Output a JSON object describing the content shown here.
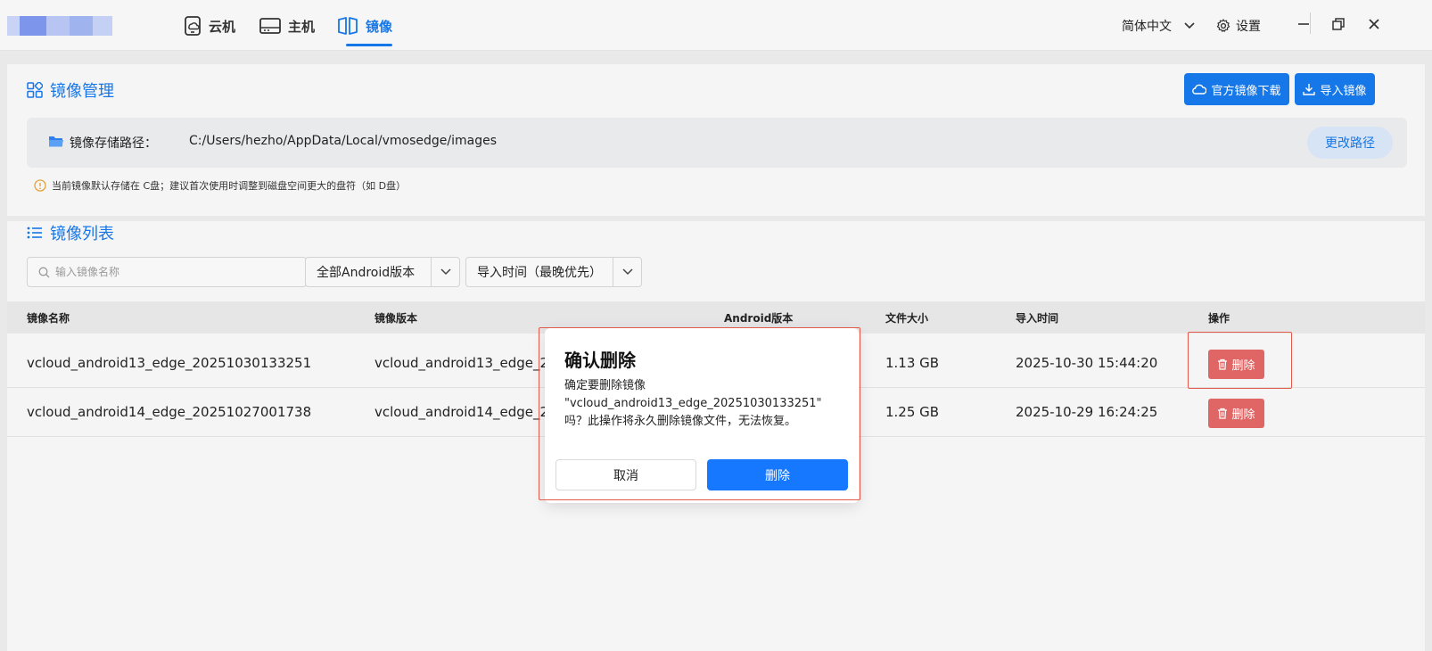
{
  "titlebar": {
    "tabs": [
      {
        "label": "云机",
        "icon": "cloud-phone-icon"
      },
      {
        "label": "主机",
        "icon": "host-icon"
      },
      {
        "label": "镜像",
        "icon": "mirror-icon",
        "active": true
      }
    ],
    "language": "简体中文",
    "settings_label": "设置"
  },
  "manage": {
    "title": "镜像管理",
    "download_button": "官方镜像下载",
    "import_button": "导入镜像",
    "path_label": "镜像存储路径：",
    "path_value": "C:/Users/hezho/AppData/Local/vmosedge/images",
    "change_path_button": "更改路径",
    "hint": "当前镜像默认存储在 C盘；建议首次使用时调整到磁盘空间更大的盘符（如 D盘）"
  },
  "list": {
    "title": "镜像列表",
    "search_placeholder": "输入镜像名称",
    "version_filter": "全部Android版本",
    "sort_filter": "导入时间（最晚优先）",
    "columns": [
      "镜像名称",
      "镜像版本",
      "Android版本",
      "文件大小",
      "导入时间",
      "操作"
    ],
    "rows": [
      {
        "name": "vcloud_android13_edge_20251030133251",
        "version": "vcloud_android13_edge_2025",
        "size": "1.13 GB",
        "time": "2025-10-30 15:44:20",
        "action": "删除"
      },
      {
        "name": "vcloud_android14_edge_20251027001738",
        "version": "vcloud_android14_edge_2025",
        "size": "1.25 GB",
        "time": "2025-10-29 16:24:25",
        "action": "删除"
      }
    ]
  },
  "dialog": {
    "title": "确认删除",
    "line1": "确定要删除镜像",
    "line2": "\"vcloud_android13_edge_20251030133251\"",
    "line3": "吗？此操作将永久删除镜像文件，无法恢复。",
    "cancel": "取消",
    "confirm": "删除"
  },
  "colors": {
    "accent": "#1677e8",
    "danger": "#e06666",
    "highlight": "#e35a4a"
  }
}
